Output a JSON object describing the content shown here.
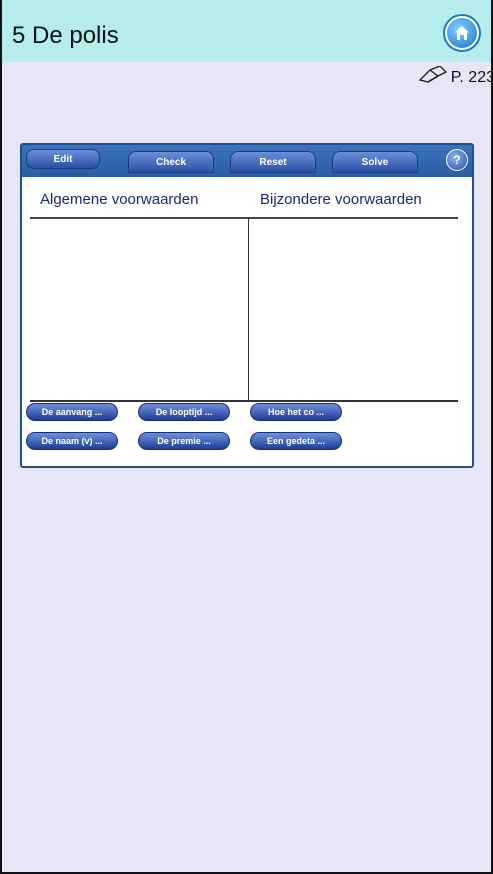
{
  "header": {
    "title": "5 De polis",
    "home_icon": "home-icon"
  },
  "page_ref": {
    "icon": "book-icon",
    "label": "P. 223"
  },
  "widget": {
    "toolbar": {
      "edit": "Edit",
      "check": "Check",
      "reset": "Reset",
      "solve": "Solve",
      "help": "?"
    },
    "columns": {
      "left": "Algemene voorwaarden",
      "right": "Bijzondere voorwaarden"
    },
    "chips": [
      "De aanvang ...",
      "De looptijd ...",
      "Hoe het co ...",
      "De naam (v) ...",
      "De premie ...",
      "Een gedeta ..."
    ]
  },
  "colors": {
    "header_bg": "#b6ecec",
    "page_bg": "#e6e6f7",
    "widget_border": "#1e4e93",
    "accent": "#1a72c9"
  }
}
